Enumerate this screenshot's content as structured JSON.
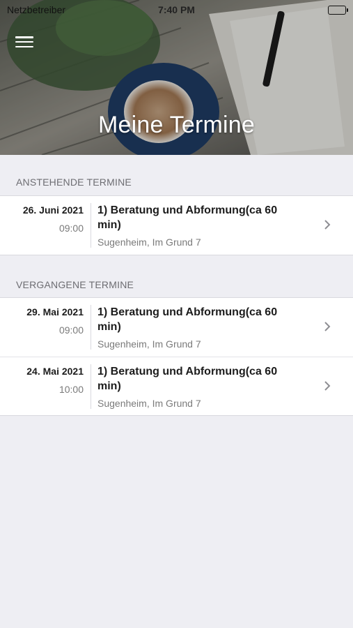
{
  "status_bar": {
    "carrier": "Netzbetreiber",
    "time": "7:40 PM"
  },
  "header": {
    "menu_icon": "hamburger-menu-icon",
    "title": "Meine Termine"
  },
  "sections": [
    {
      "title": "ANSTEHENDE TERMINE",
      "appointments": [
        {
          "date": "26. Juni 2021",
          "time": "09:00",
          "title": "1) Beratung und Abformung(ca 60 min)",
          "location": "Sugenheim, Im Grund 7"
        }
      ]
    },
    {
      "title": "VERGANGENE TERMINE",
      "appointments": [
        {
          "date": "29. Mai 2021",
          "time": "09:00",
          "title": "1) Beratung und Abformung(ca 60 min)",
          "location": "Sugenheim, Im Grund 7"
        },
        {
          "date": "24. Mai 2021",
          "time": "10:00",
          "title": "1) Beratung und Abformung(ca 60 min)",
          "location": "Sugenheim, Im Grund 7"
        }
      ]
    }
  ],
  "colors": {
    "background": "#eeeef3",
    "card": "#ffffff",
    "section_text": "#6d6d72",
    "secondary_text": "#7a7a7a",
    "chevron": "#8e8e93"
  }
}
